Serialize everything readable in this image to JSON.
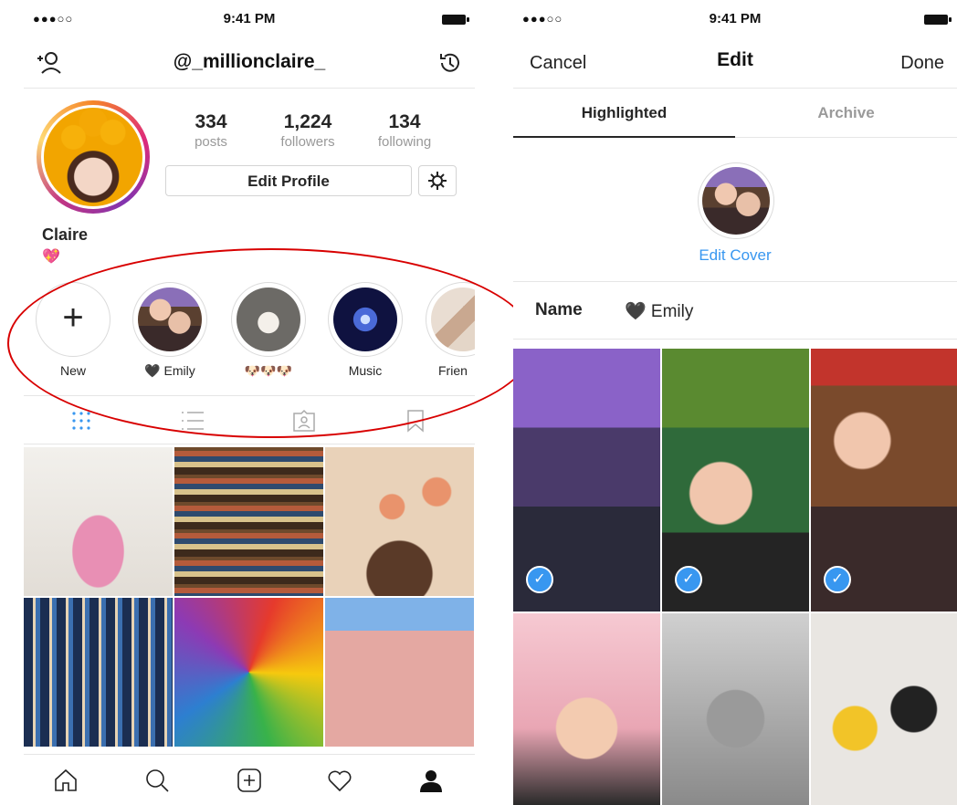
{
  "left_screen": {
    "status_bar": {
      "signal": "●●●○○",
      "time": "9:41 PM"
    },
    "nav": {
      "username": "@_millionclaire_"
    },
    "stats": [
      {
        "number": "334",
        "label": "posts"
      },
      {
        "number": "1,224",
        "label": "followers"
      },
      {
        "number": "134",
        "label": "following"
      }
    ],
    "edit_profile_label": "Edit Profile",
    "profile_name": "Claire",
    "profile_emoji": "💖",
    "highlights": [
      {
        "label": "New"
      },
      {
        "label": "🖤 Emily"
      },
      {
        "label": "🐶🐶🐶"
      },
      {
        "label": "Music"
      },
      {
        "label": "Frien"
      }
    ]
  },
  "right_screen": {
    "status_bar": {
      "signal": "●●●○○",
      "time": "9:41 PM"
    },
    "nav": {
      "cancel": "Cancel",
      "title": "Edit",
      "done": "Done"
    },
    "segments": {
      "highlighted": "Highlighted",
      "archive": "Archive"
    },
    "edit_cover_label": "Edit Cover",
    "name_label": "Name",
    "name_value": "🖤 Emily",
    "checkmark": "✓"
  },
  "colors": {
    "accent_blue": "#3897f0",
    "annotation_red": "#d80000",
    "divider": "#e6e6e6"
  }
}
